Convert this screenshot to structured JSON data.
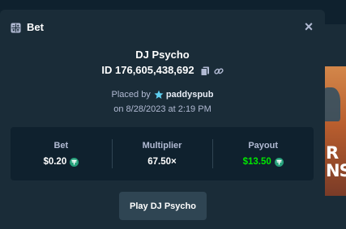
{
  "modal": {
    "title": "Bet",
    "close_label": "×"
  },
  "bet": {
    "game_name": "DJ Psycho",
    "id_text": "ID 176,605,438,692",
    "placed_by_label": "Placed by",
    "username": "paddyspub",
    "placed_date": "on 8/28/2023 at 2:19 PM"
  },
  "stats": [
    {
      "label": "Bet",
      "value": "$0.20",
      "currency_icon": "usdt-coin-icon",
      "has_icon": true
    },
    {
      "label": "Multiplier",
      "value": "67.50×",
      "has_icon": false
    },
    {
      "label": "Payout",
      "value": "$13.50",
      "currency_icon": "usdt-coin-icon",
      "has_icon": true
    }
  ],
  "actions": {
    "play_button_label": "Play DJ Psycho"
  },
  "background": {
    "banner_text": "R\nNS"
  },
  "colors": {
    "modal_bg": "#1a2c38",
    "panel_bg": "#0f212e",
    "button_bg": "#2f4553",
    "muted_text": "#b1bad3",
    "payout_green": "#00e701",
    "coin_teal": "#26a17b"
  }
}
